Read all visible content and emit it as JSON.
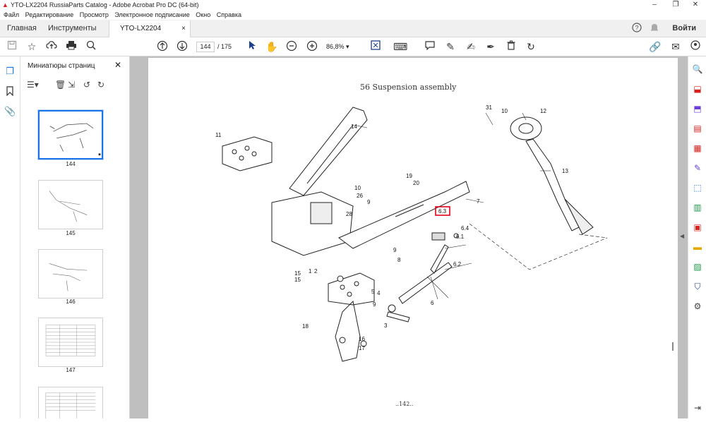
{
  "window": {
    "title": "YTO-LX2204 RussiaParts Catalog - Adobe Acrobat Pro DC (64-bit)",
    "minimize": "–",
    "restore": "❐",
    "close": "✕"
  },
  "menu": [
    "Файл",
    "Редактирование",
    "Просмотр",
    "Электронное подписание",
    "Окно",
    "Справка"
  ],
  "tabs": {
    "home": "Главная",
    "tools": "Инструменты",
    "document": "YTO-LX2204 Russia...",
    "document_close": "×",
    "login": "Войти"
  },
  "toolbar": {
    "page_current": "144",
    "page_total": "/ 175",
    "zoom": "86,8%"
  },
  "thumbnails": {
    "header": "Миниатюры страниц",
    "close": "✕",
    "pages": [
      "144",
      "145",
      "146",
      "147"
    ]
  },
  "document": {
    "heading": "56 Suspension assembly",
    "page_number": "..142..",
    "callouts": [
      "1",
      "2",
      "3",
      "4",
      "5",
      "6",
      "6.1",
      "6.2",
      "6.3",
      "6.4",
      "7",
      "8",
      "9",
      "9",
      "9",
      "10",
      "10",
      "11",
      "12",
      "13",
      "14",
      "15",
      "15",
      "16",
      "17",
      "18",
      "19",
      "20",
      "26",
      "28",
      "31"
    ],
    "highlighted": "6.3",
    "highlight_color": "#e0001a"
  },
  "colors": {
    "accent": "#1a73e8",
    "acrobat_red": "#d8201c",
    "viewer_bg": "#bfbfbf"
  }
}
